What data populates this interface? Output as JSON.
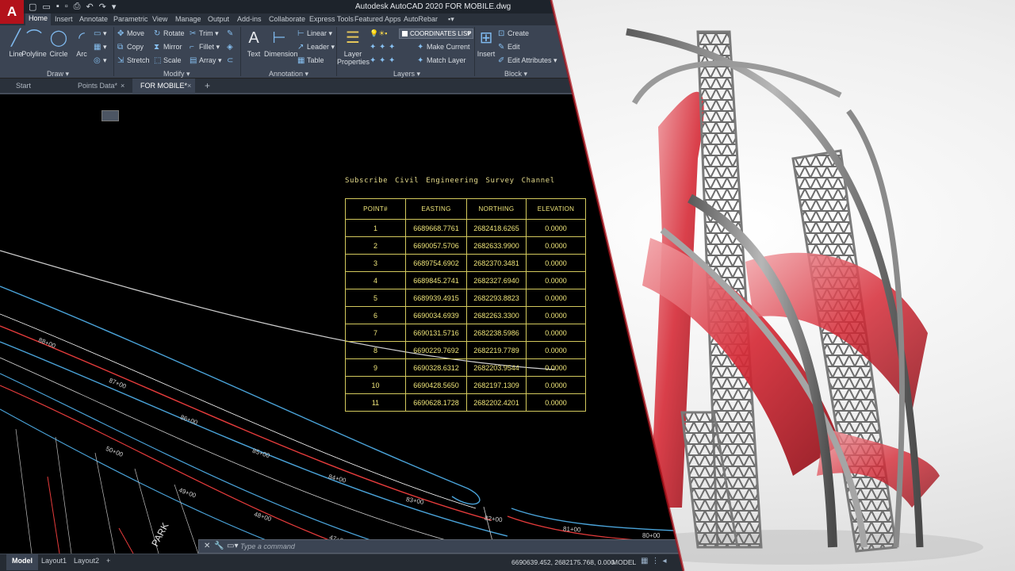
{
  "window": {
    "app_logo": "A",
    "title": "Autodesk AutoCAD 2020   FOR MOBILE.dwg"
  },
  "ribbon_tabs": [
    "Home",
    "Insert",
    "Annotate",
    "Parametric",
    "View",
    "Manage",
    "Output",
    "Add-ins",
    "Collaborate",
    "Express Tools",
    "Featured Apps",
    "AutoRebar"
  ],
  "panels": {
    "draw": {
      "title": "Draw ▾",
      "line": "Line",
      "polyline": "Polyline",
      "circle": "Circle",
      "arc": "Arc"
    },
    "modify": {
      "title": "Modify ▾",
      "move": "Move",
      "rotate": "Rotate",
      "trim": "Trim ▾",
      "copy": "Copy",
      "mirror": "Mirror",
      "fillet": "Fillet ▾",
      "stretch": "Stretch",
      "scale": "Scale",
      "array": "Array ▾"
    },
    "annotation": {
      "title": "Annotation ▾",
      "text": "Text",
      "dimension": "Dimension",
      "linear": "Linear ▾",
      "leader": "Leader ▾",
      "table": "Table"
    },
    "layers": {
      "title": "Layers ▾",
      "layer_properties": "Layer Properties",
      "current_layer": "COORDINATES LISP",
      "make_current": "Make Current",
      "match_layer": "Match Layer"
    },
    "block": {
      "title": "Block ▾",
      "insert": "Insert",
      "create": "Create",
      "edit": "Edit",
      "edit_attributes": "Edit Attributes ▾"
    }
  },
  "file_tabs": [
    "Start",
    "Points Data*",
    "FOR MOBILE*"
  ],
  "drawing": {
    "caption": "Subscribe Civil Engineering Survey Channel",
    "table": {
      "headers": [
        "POINT#",
        "EASTING",
        "NORTHING",
        "ELEVATION"
      ],
      "rows": [
        [
          "1",
          "6689668.7761",
          "2682418.6265",
          "0.0000"
        ],
        [
          "2",
          "6690057.5706",
          "2682633.9900",
          "0.0000"
        ],
        [
          "3",
          "6689754.6902",
          "2682370.3481",
          "0.0000"
        ],
        [
          "4",
          "6689845.2741",
          "2682327.6940",
          "0.0000"
        ],
        [
          "5",
          "6689939.4915",
          "2682293.8823",
          "0.0000"
        ],
        [
          "6",
          "6690034.6939",
          "2682263.3300",
          "0.0000"
        ],
        [
          "7",
          "6690131.5716",
          "2682238.5986",
          "0.0000"
        ],
        [
          "8",
          "6690229.7692",
          "2682219.7789",
          "0.0000"
        ],
        [
          "9",
          "6690328.6312",
          "2682203.9544",
          "0.0000"
        ],
        [
          "10",
          "6690428.5650",
          "2682197.1309",
          "0.0000"
        ],
        [
          "11",
          "6690628.1728",
          "2682202.4201",
          "0.0000"
        ]
      ]
    },
    "stations": [
      "88+00",
      "87+00",
      "86+00",
      "85+00",
      "84+00",
      "83+00",
      "82+00",
      "81+00",
      "80+00",
      "50+00",
      "49+00",
      "48+00",
      "47+00"
    ],
    "street_label": "PARK"
  },
  "command": {
    "placeholder": "Type a command"
  },
  "status": {
    "layout_tabs": [
      "Model",
      "Layout1",
      "Layout2"
    ],
    "add_tab": "+",
    "coordinates": "6690639.452, 2682175.768, 0.000",
    "model_button": "MODEL"
  },
  "colors": {
    "accent": "#b3121b",
    "ribbon": "#3b4453",
    "table_lines": "#d3c95d",
    "table_text": "#f0e67a"
  },
  "icons": [
    "line-icon",
    "polyline-icon",
    "circle-icon",
    "arc-icon",
    "text-icon",
    "dimension-icon",
    "layer-properties-icon",
    "insert-block-icon",
    "wrench-icon",
    "close-icon"
  ]
}
